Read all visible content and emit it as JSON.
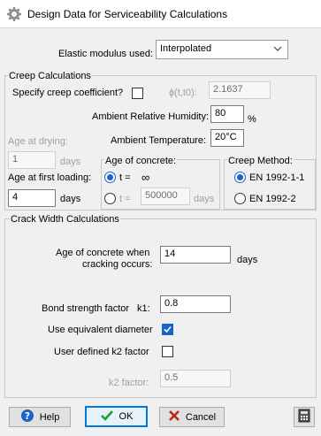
{
  "window": {
    "title": "Design Data for Serviceability Calculations"
  },
  "elastic": {
    "label": "Elastic modulus used:",
    "value": "Interpolated"
  },
  "creep": {
    "section_title": "Creep Calculations",
    "specify_label": "Specify creep coefficient?",
    "specify_checked": false,
    "phi_label": "ɸ(t,t0):",
    "phi_value": "2.1637",
    "humidity_label": "Ambient Relative Humidity:",
    "humidity_value": "80",
    "humidity_unit": "%",
    "temperature_label": "Ambient Temperature:",
    "temperature_value": "20°C",
    "drying_label": "Age at drying:",
    "drying_value": "1",
    "drying_unit": "days",
    "loading_label": "Age at first loading:",
    "loading_value": "4",
    "loading_unit": "days",
    "age_group_title": "Age of concrete:",
    "age_option1_label": "t =",
    "age_option1_value": "∞",
    "age_option2_label": "t =",
    "age_option2_value": "500000",
    "age_option2_unit": "days",
    "method_title": "Creep Method:",
    "method1": "EN 1992-1-1",
    "method2": "EN 1992-2"
  },
  "crack": {
    "section_title": "Crack Width Calculations",
    "age_label_line1": "Age of concrete when",
    "age_label_line2": "cracking occurs:",
    "age_value": "14",
    "age_unit": "days",
    "bond_label": "Bond strength factor",
    "bond_symbol": "k1:",
    "bond_value": "0.8",
    "equiv_label": "Use equivalent diameter",
    "equiv_checked": true,
    "k2_user_label": "User defined k2 factor",
    "k2_user_checked": false,
    "k2_label": "k2 factor:",
    "k2_value": "0.5"
  },
  "buttons": {
    "help": "Help",
    "ok": "OK",
    "cancel": "Cancel"
  },
  "icons": {
    "gear": "gear-icon",
    "help": "help-icon",
    "ok": "check-icon",
    "cancel": "cross-icon",
    "calculator": "calculator-icon",
    "combo": "chevron-down-icon"
  },
  "colors": {
    "accent": "#1a63c7",
    "ok_green": "#1f9e3a",
    "cancel_red": "#c0241b"
  }
}
